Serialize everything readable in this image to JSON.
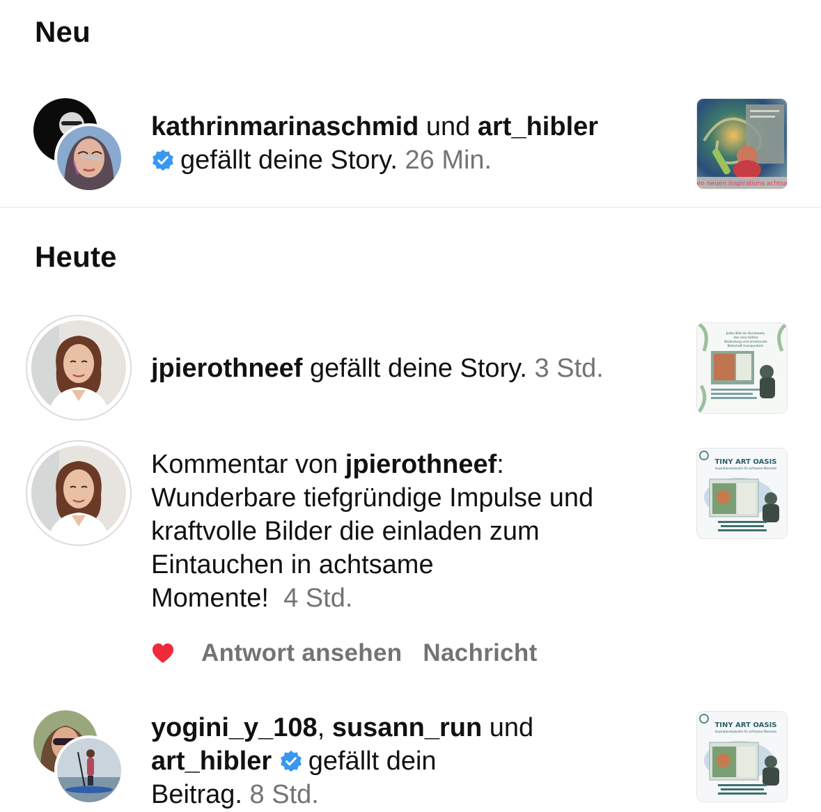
{
  "sections": {
    "neu": {
      "title": "Neu"
    },
    "heute": {
      "title": "Heute"
    }
  },
  "notif1": {
    "user1": "kathrinmarinaschmid",
    "connector": "und",
    "user2": "art_hibler",
    "text": "gefällt deine Story.",
    "time": "26 Min.",
    "thumb_caption": "einen neuen inspirations achtsame"
  },
  "notif2": {
    "user": "jpierothneef",
    "text": "gefällt deine Story.",
    "time": "3 Std.",
    "thumb_lines": [
      "Jedes Bild ein Kunstwerk,",
      "das eine tiefere",
      "Bedeutung und emotionale",
      "Botschaft transportiert."
    ]
  },
  "notif3": {
    "prefix": "Kommentar von",
    "user": "jpierothneef",
    "colon": ":",
    "line1": "Wunderbare tiefgründige Impulse und",
    "line2": "kraftvolle Bilder die einladen zum",
    "line3": "Eintauchen in achtsame",
    "line4": "Momente!",
    "time": "4 Std.",
    "thumb_title": "TINY ART OASIS",
    "thumb_sub": "Inspirationskalender für achtsame Momente",
    "actions": {
      "view_reply": "Antwort ansehen",
      "message": "Nachricht"
    }
  },
  "notif4": {
    "user1": "yogini_y_108",
    "comma": ",",
    "user2": "susann_run",
    "connector": "und",
    "user3": "art_hibler",
    "text1": "gefällt dein",
    "text2": "Beitrag.",
    "time": "8 Std.",
    "thumb_title": "TINY ART OASIS",
    "thumb_sub": "Inspirationskalender für achtsame Momente"
  },
  "colors": {
    "verified": "#3897f0",
    "heart": "#ed2b3a",
    "muted": "#737373"
  },
  "icons": [
    "verified-badge-icon",
    "heart-icon"
  ]
}
